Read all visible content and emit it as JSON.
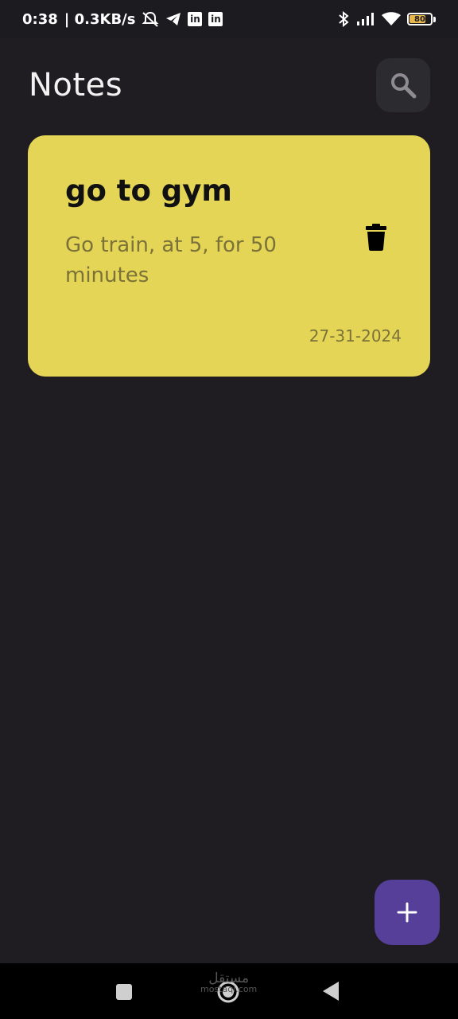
{
  "status_bar": {
    "time": "0:38",
    "network_speed": "| 0.3KB/s",
    "battery_level": 80,
    "battery_label": "80",
    "icons": [
      "mute-icon",
      "telegram-icon",
      "linkedin-icon",
      "linkedin-icon",
      "bluetooth-icon",
      "signal-icon",
      "wifi-icon",
      "battery-icon"
    ],
    "linkedin_glyph": "in"
  },
  "header": {
    "title": "Notes",
    "search_icon": "search-icon"
  },
  "notes": [
    {
      "title": "go to gym",
      "body": "Go train, at 5, for 50 minutes",
      "date": "27-31-2024",
      "color": "#e5d556",
      "delete_icon": "trash-icon"
    }
  ],
  "fab": {
    "icon": "plus-icon",
    "color": "#553f99"
  },
  "nav_bar": {
    "buttons": [
      "recent-apps-icon",
      "home-icon",
      "back-icon"
    ]
  },
  "watermark": {
    "line1": "مستقل",
    "line2": "mostaql.com"
  },
  "colors": {
    "background": "#1f1d22",
    "search_button": "#2c2b30"
  }
}
